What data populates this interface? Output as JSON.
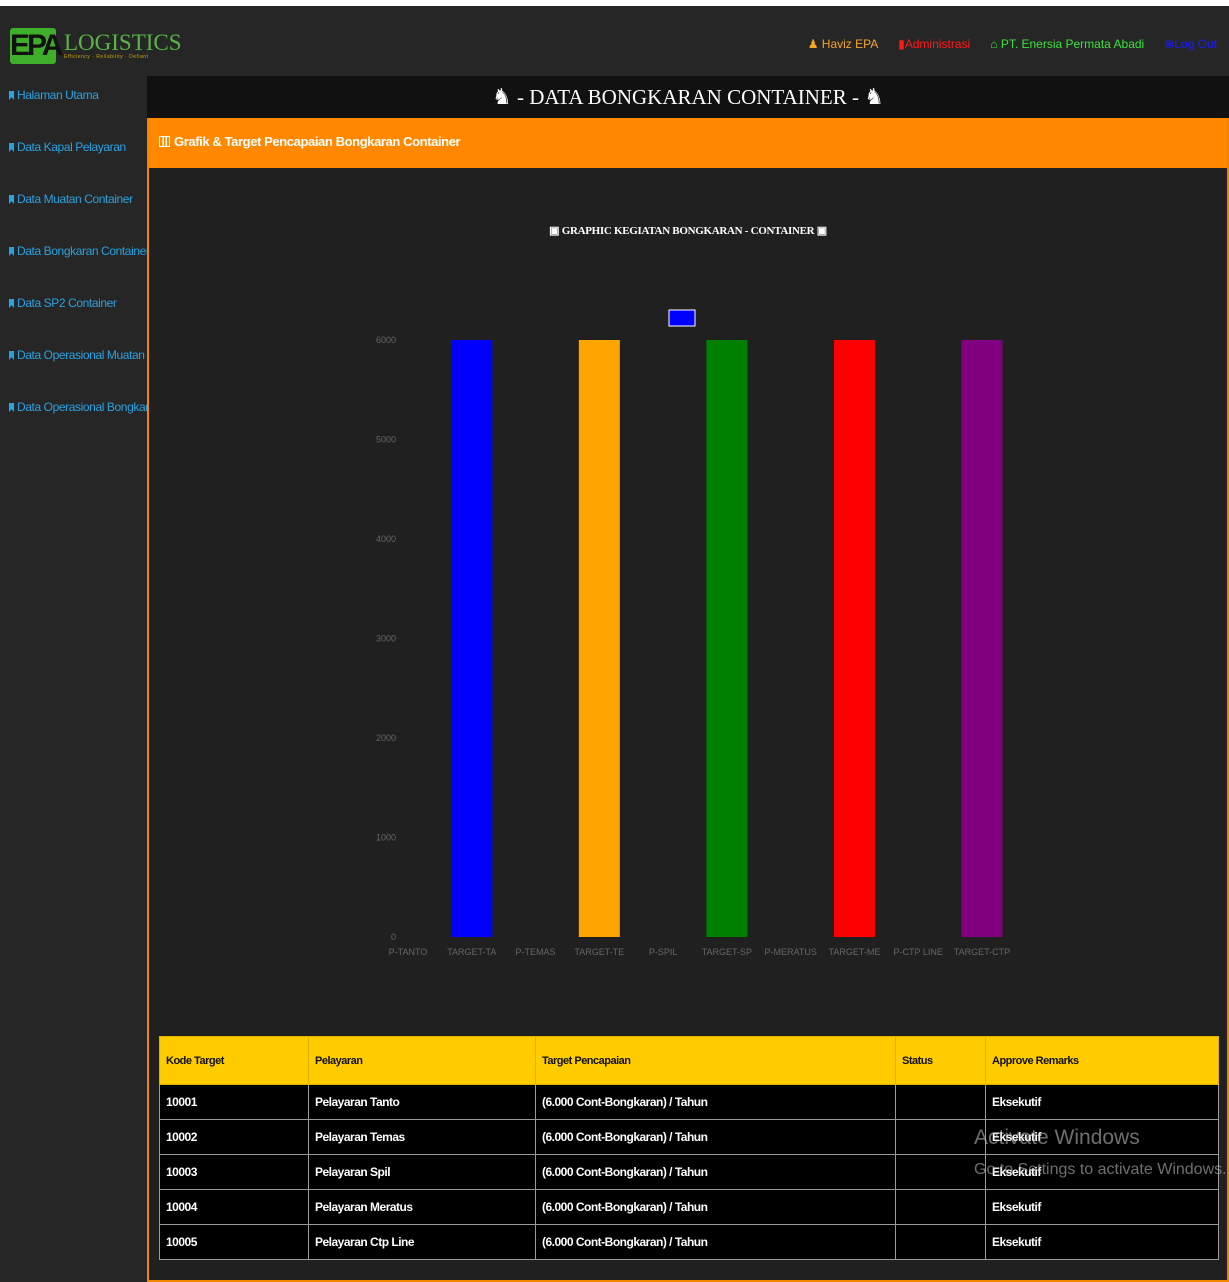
{
  "header": {
    "logo_text": "LOGISTICS",
    "logo_mark": "EPA",
    "logo_tagline": "Efficiency · Reliability · Defiant",
    "nav": {
      "user": "Haviz EPA",
      "admin": "Administrasi",
      "company": "PT. Enersia Permata Abadi",
      "logout": "Log Out"
    }
  },
  "sidebar": {
    "items": [
      {
        "label": "Halaman Utama"
      },
      {
        "label": "Data Kapal Pelayaran"
      },
      {
        "label": "Data Muatan Container"
      },
      {
        "label": "Data Bongkaran Container"
      },
      {
        "label": "Data SP2 Container"
      },
      {
        "label": "Data Operasional Muatan"
      },
      {
        "label": "Data Operasional Bongkaran"
      }
    ]
  },
  "page": {
    "title": "- DATA BONGKARAN CONTAINER -",
    "panel_title": "Grafik & Target Pencapaian Bongkaran Container",
    "chart_title": "GRAPHIC KEGIATAN BONGKARAN - CONTAINER"
  },
  "chart_data": {
    "type": "bar",
    "title": "GRAPHIC KEGIATAN BONGKARAN - CONTAINER",
    "categories": [
      "P-TANTO",
      "TARGET-TA",
      "P-TEMAS",
      "TARGET-TE",
      "P-SPIL",
      "TARGET-SP",
      "P-MERATUS",
      "TARGET-ME",
      "P-CTP LINE",
      "TARGET-CTP"
    ],
    "values": [
      0,
      6000,
      0,
      6000,
      0,
      6000,
      0,
      6000,
      0,
      6000
    ],
    "colors": [
      "#0000ff",
      "#0000ff",
      "#ffa500",
      "#ffa500",
      "#008000",
      "#008000",
      "#ff0000",
      "#ff0000",
      "#800080",
      "#800080"
    ],
    "legend_color": "#0000ff",
    "y_ticks": [
      0,
      1000,
      2000,
      3000,
      4000,
      5000,
      6000
    ],
    "ylim": [
      0,
      6000
    ],
    "grid": false,
    "legend": "top-center"
  },
  "table": {
    "headers": [
      "Kode Target",
      "Pelayaran",
      "Target Pencapaian",
      "Status",
      "Approve Remarks"
    ],
    "rows": [
      [
        "10001",
        "Pelayaran Tanto",
        "(6.000 Cont-Bongkaran) / Tahun",
        "",
        "Eksekutif"
      ],
      [
        "10002",
        "Pelayaran Temas",
        "(6.000 Cont-Bongkaran) / Tahun",
        "",
        "Eksekutif"
      ],
      [
        "10003",
        "Pelayaran Spil",
        "(6.000 Cont-Bongkaran) / Tahun",
        "",
        "Eksekutif"
      ],
      [
        "10004",
        "Pelayaran Meratus",
        "(6.000 Cont-Bongkaran) / Tahun",
        "",
        "Eksekutif"
      ],
      [
        "10005",
        "Pelayaran Ctp Line",
        "(6.000 Cont-Bongkaran) / Tahun",
        "",
        "Eksekutif"
      ]
    ]
  },
  "watermark": {
    "line1": "Activate Windows",
    "line2": "Go to Settings to activate Windows."
  }
}
